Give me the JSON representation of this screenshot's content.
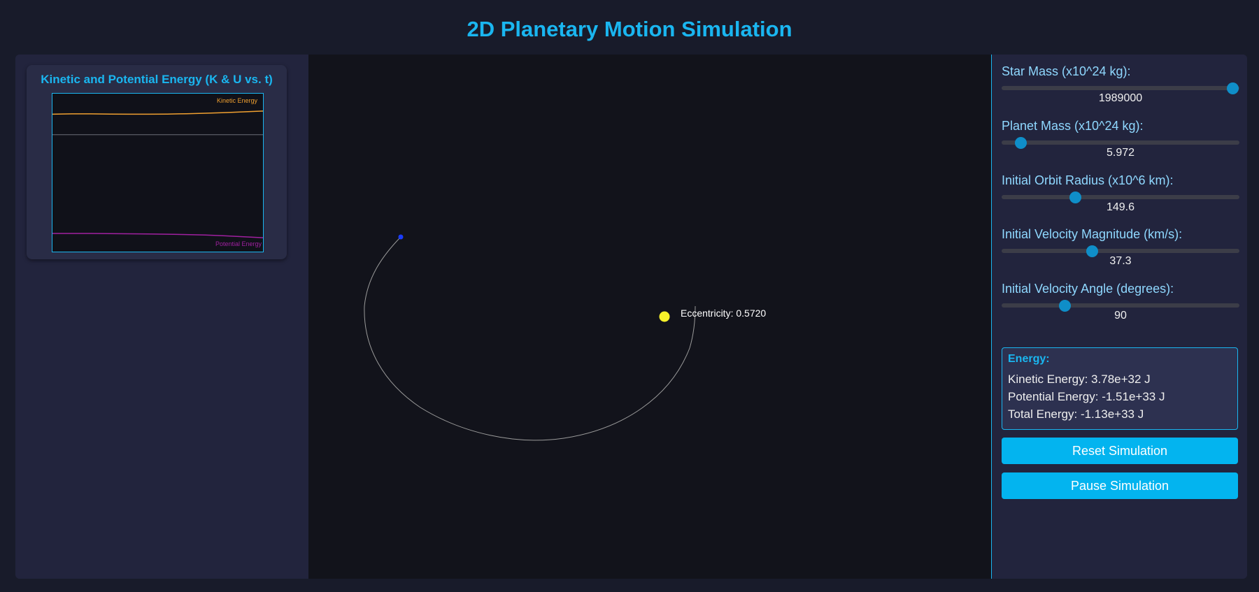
{
  "page": {
    "title": "2D Planetary Motion Simulation"
  },
  "colors": {
    "accent": "#1ab6f0",
    "kinetic": "#f0a030",
    "potential": "#a020a0",
    "star": "#f7f22a",
    "planet": "#1a3cff",
    "orbit": "#9a9a9a",
    "button": "#03b4ef"
  },
  "energy_chart": {
    "title": "Kinetic and Potential Energy (K & U vs. t)",
    "kinetic_label": "Kinetic Energy",
    "potential_label": "Potential Energy"
  },
  "chart_data": {
    "type": "line",
    "title": "Kinetic and Potential Energy (K & U vs. t)",
    "xlabel": "",
    "ylabel": "",
    "series": [
      {
        "name": "Kinetic Energy",
        "color": "#f0a030",
        "values": [
          0.87,
          0.872,
          0.872,
          0.871,
          0.87,
          0.87,
          0.871,
          0.873,
          0.876,
          0.88,
          0.885,
          0.89
        ]
      },
      {
        "name": "Potential Energy",
        "color": "#a020a0",
        "values": [
          0.115,
          0.115,
          0.115,
          0.114,
          0.113,
          0.112,
          0.11,
          0.108,
          0.105,
          0.1,
          0.094,
          0.088
        ]
      }
    ],
    "reference_line": 0.74,
    "ylim": [
      0,
      1
    ]
  },
  "simulation": {
    "eccentricity_label": "Eccentricity: 0.5720"
  },
  "controls": [
    {
      "label": "Star Mass (x10^24 kg):",
      "value": "1989000",
      "fraction": 0.97
    },
    {
      "label": "Planet Mass (x10^24 kg):",
      "value": "5.972",
      "fraction": 0.08
    },
    {
      "label": "Initial Orbit Radius (x10^6 km):",
      "value": "149.6",
      "fraction": 0.31
    },
    {
      "label": "Initial Velocity Magnitude (km/s):",
      "value": "37.3",
      "fraction": 0.38
    },
    {
      "label": "Initial Velocity Angle (degrees):",
      "value": "90",
      "fraction": 0.265
    }
  ],
  "energy_info": {
    "title": "Energy:",
    "kinetic": "Kinetic Energy: 3.78e+32 J",
    "potential": "Potential Energy: -1.51e+33 J",
    "total": "Total Energy: -1.13e+33 J"
  },
  "buttons": {
    "reset": "Reset Simulation",
    "pause": "Pause Simulation"
  }
}
